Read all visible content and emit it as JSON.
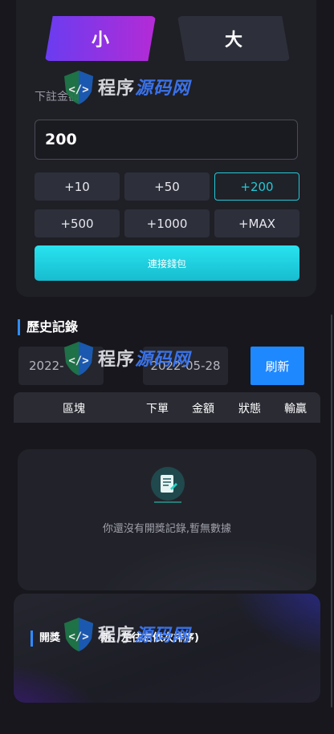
{
  "bet_type": {
    "small_label": "小",
    "big_label": "大"
  },
  "bet": {
    "label": "下註金額",
    "amount": "200",
    "chips": [
      "+10",
      "+50",
      "+200",
      "+500",
      "+1000",
      "+MAX"
    ],
    "active_chip": "+200"
  },
  "connect_wallet_label": "連接錢包",
  "history": {
    "title": "歷史記錄",
    "date_start": "2022-",
    "date_end": "2022-05-28",
    "refresh_label": "刷新",
    "columns": [
      "區塊",
      "下單",
      "金額",
      "狀態",
      "輸贏"
    ],
    "empty_text": "你還沒有開獎記錄,暫無數據"
  },
  "draw_section": {
    "title": "開獎",
    "note": "新，左往右依次排序)"
  },
  "watermark": {
    "text_white": "程序",
    "text_blue": "源码网"
  },
  "colors": {
    "accent": "#2f8bff",
    "cyan": "#23c9d8",
    "purple": "#b42bd6"
  }
}
